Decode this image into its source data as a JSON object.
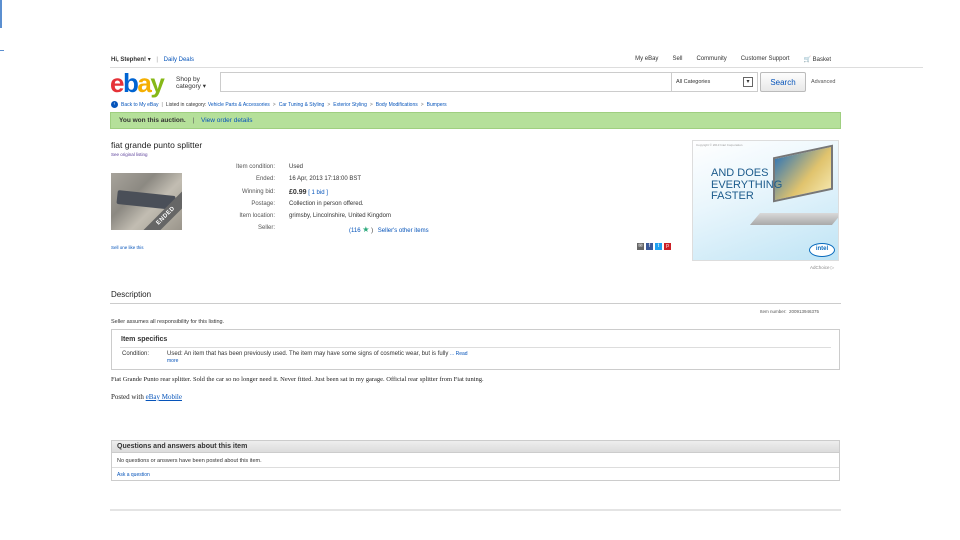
{
  "header": {
    "greeting": "Hi, Stephen!",
    "greeting_arrow": "▾",
    "separator": "|",
    "daily_deals": "Daily Deals",
    "links": [
      "My eBay",
      "Sell",
      "Community",
      "Customer Support"
    ],
    "basket": "Basket"
  },
  "logo": {
    "letters": [
      "e",
      "b",
      "a",
      "y"
    ],
    "colors": [
      "#e53238",
      "#0064d2",
      "#f5af02",
      "#86b817"
    ]
  },
  "shop_by": {
    "line1": "Shop by",
    "line2": "category"
  },
  "search": {
    "category": "All Categories",
    "button": "Search",
    "advanced": "Advanced"
  },
  "breadcrumb": {
    "back": "Back to My eBay",
    "listed_in": "Listed in category:",
    "items": [
      "Vehicle Parts & Accessories",
      "Car Tuning & Styling",
      "Exterior Styling",
      "Body Modifications",
      "Bumpers"
    ]
  },
  "won_bar": {
    "text": "You won this auction.",
    "link": "View order details"
  },
  "item": {
    "title": "fiat grande punto splitter",
    "see_original": "See original listing",
    "ended_badge": "ENDED",
    "condition_label": "Item condition:",
    "condition": "Used",
    "ended_label": "Ended:",
    "ended": "16 Apr, 2013  17:18:00 BST",
    "bid_label": "Winning bid:",
    "bid": "£0.99",
    "bids": "[ 1 bid ]",
    "postage_label": "Postage:",
    "postage": "Collection in person offered.",
    "location_label": "Item location:",
    "location": "grimsby, Lincolnshire, United Kingdom",
    "seller_label": "Seller:",
    "seller_feedback": "(116",
    "seller_close": ")",
    "seller_other": "Seller's other items",
    "sell_one": "Sell one like this"
  },
  "ad": {
    "tiny": "Copyright © 2013 Intel Corporation",
    "line1": "AND DOES",
    "line2": "EVERYTHING",
    "line3": "FASTER",
    "brand": "intel",
    "adchoice": "AdChoice"
  },
  "description": {
    "heading": "Description",
    "item_number_label": "Item number:",
    "item_number": "200913946375",
    "assumes": "Seller assumes all responsibility for this listing.",
    "specifics_heading": "Item specifics",
    "condition_label": "Condition:",
    "condition_text": "Used: An item that has been previously used. The item may have some signs of cosmetic wear, but is fully",
    "read_more": "... Read more",
    "body": "Fiat Grande Punto rear splitter. Sold the car so no longer need it. Never fitted. Just been sat in my garage. Official rear splitter from Fiat tuning.",
    "posted_with": "Posted with",
    "posted_link": "eBay Mobile"
  },
  "qa": {
    "heading": "Questions and answers about this item",
    "none": "No questions or answers have been posted about this item.",
    "ask": "Ask a question"
  },
  "share_colors": [
    "#666666",
    "#3b5998",
    "#1da1f2",
    "#cb2027"
  ]
}
